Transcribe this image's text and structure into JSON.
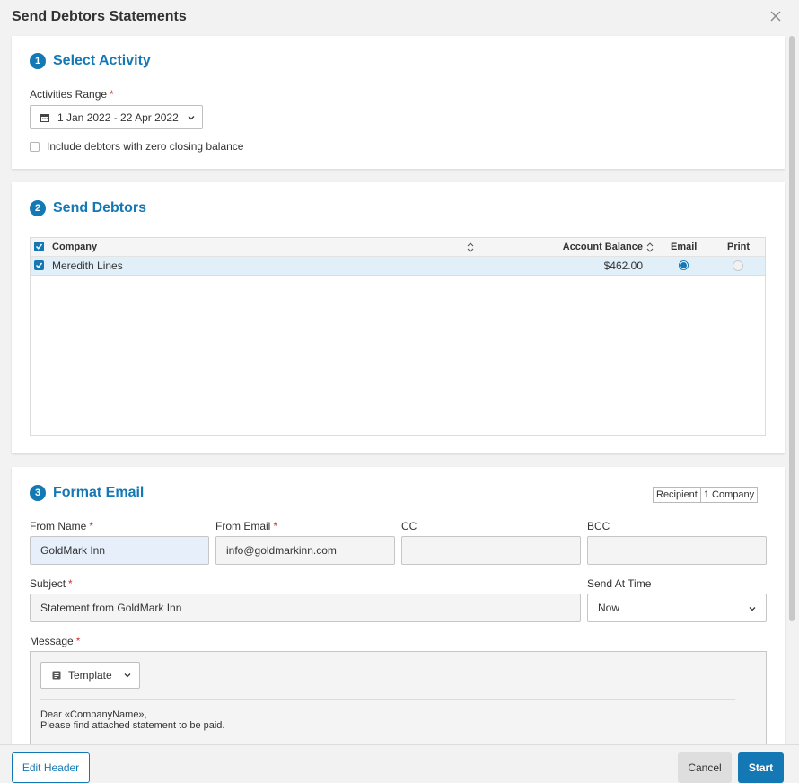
{
  "dialog": {
    "title": "Send Debtors Statements"
  },
  "step1": {
    "number": "1",
    "title": "Select Activity",
    "range_label": "Activities Range",
    "range_value": "1 Jan 2022 - 22 Apr 2022",
    "zero_balance_label": "Include debtors with zero closing balance",
    "zero_balance_checked": false
  },
  "step2": {
    "number": "2",
    "title": "Send Debtors",
    "columns": {
      "company": "Company",
      "balance": "Account Balance",
      "email": "Email",
      "print": "Print"
    },
    "rows": [
      {
        "company": "Meredith Lines",
        "balance": "$462.00",
        "selected": true,
        "delivery": "email"
      }
    ]
  },
  "step3": {
    "number": "3",
    "title": "Format Email",
    "recipient": {
      "label": "Recipient",
      "value": "1 Company"
    },
    "from_name": {
      "label": "From Name",
      "value": "GoldMark Inn"
    },
    "from_email": {
      "label": "From Email",
      "value": "info@goldmarkinn.com"
    },
    "cc": {
      "label": "CC",
      "value": ""
    },
    "bcc": {
      "label": "BCC",
      "value": ""
    },
    "subject": {
      "label": "Subject",
      "value": "Statement from GoldMark Inn"
    },
    "send_at": {
      "label": "Send At Time",
      "value": "Now"
    },
    "message": {
      "label": "Message",
      "template_label": "Template",
      "line1": "Dear «CompanyName»,",
      "line2": "Please find attached statement to be paid."
    }
  },
  "footer": {
    "edit_header": "Edit Header",
    "cancel": "Cancel",
    "start": "Start"
  },
  "colors": {
    "accent": "#1478b4",
    "required": "#d0312d",
    "selected_row": "#e1f0f8"
  }
}
